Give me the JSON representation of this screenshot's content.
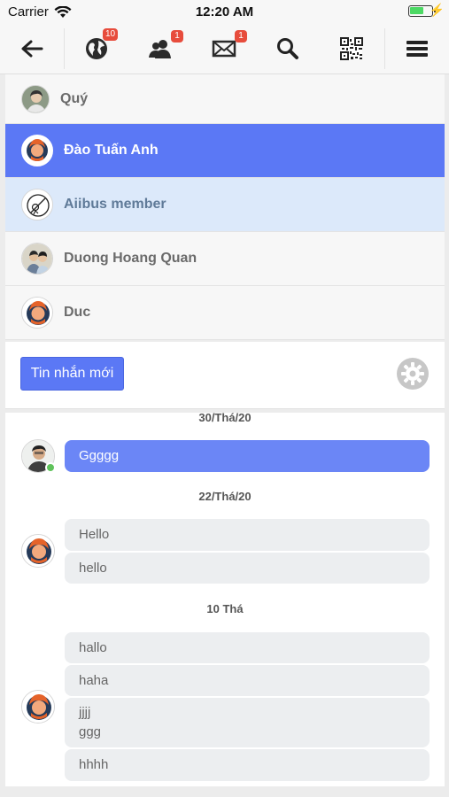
{
  "status_bar": {
    "carrier": "Carrier",
    "time": "12:20 AM"
  },
  "nav": {
    "items": [
      {
        "name": "back",
        "icon": "back-arrow-icon"
      },
      {
        "name": "globe",
        "icon": "globe-icon",
        "badge": "10"
      },
      {
        "name": "friends",
        "icon": "friends-icon",
        "badge": "1"
      },
      {
        "name": "mail",
        "icon": "mail-icon",
        "badge": "1"
      },
      {
        "name": "search",
        "icon": "search-icon"
      },
      {
        "name": "qr",
        "icon": "qr-code-icon"
      },
      {
        "name": "menu",
        "icon": "menu-icon"
      }
    ]
  },
  "contacts": [
    {
      "name": "Quý",
      "state": "normal"
    },
    {
      "name": "Đào Tuấn Anh",
      "state": "active"
    },
    {
      "name": "Aiibus member",
      "state": "highlight"
    },
    {
      "name": "Duong Hoang Quan",
      "state": "normal"
    },
    {
      "name": "Duc",
      "state": "normal"
    }
  ],
  "actions": {
    "new_message_label": "Tin nhắn mới",
    "settings_icon": "gear-icon"
  },
  "messages": {
    "groups": [
      {
        "date": "30/Thá/20",
        "direction": "out",
        "bubbles": [
          "Ggggg"
        ]
      },
      {
        "date": "22/Thá/20",
        "direction": "in",
        "bubbles": [
          "Hello",
          "hello"
        ]
      },
      {
        "date": "10 Thá",
        "direction": "in",
        "bubbles": [
          "hallo",
          "haha",
          "jjjj\nggg",
          "hhhh"
        ]
      }
    ]
  },
  "colors": {
    "accent": "#5b78f5",
    "highlight": "#dce9fa",
    "badge": "#e74c3c",
    "online": "#5fc25b"
  }
}
